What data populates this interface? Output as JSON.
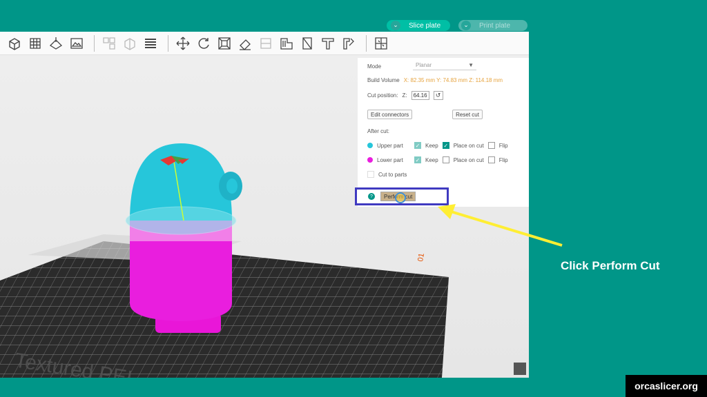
{
  "titlebar": {
    "slice_label": "Slice plate",
    "print_label": "Print plate",
    "dropdown_glyph": "⌄"
  },
  "toolbar": {
    "icons": [
      "add-object-icon",
      "grid-arrange-icon",
      "orient-icon",
      "plate-view-icon",
      "split-objects-icon",
      "split-parts-icon",
      "layers-icon",
      "move-icon",
      "rotate-icon",
      "scale-icon",
      "lay-on-face-icon",
      "cut-icon",
      "variable-layer-icon",
      "seam-icon",
      "text-icon",
      "support-paint-icon",
      "assembly-icon"
    ]
  },
  "cut_panel": {
    "mode_label": "Mode",
    "mode_value": "Planar",
    "mode_arrow": "▼",
    "build_volume_label": "Build Volume",
    "build_volume_values": "X: 82.35 mm  Y: 74.83 mm  Z: 114.18 mm",
    "cut_position_label": "Cut position:",
    "axis_label": "Z:",
    "cut_position_value": "64.16",
    "reset_glyph": "↺",
    "edit_connectors_label": "Edit connectors",
    "reset_cut_label": "Reset cut",
    "after_cut_label": "After cut:",
    "upper_part_label": "Upper part",
    "lower_part_label": "Lower part",
    "keep_label": "Keep",
    "place_on_cut_label": "Place on cut",
    "flip_label": "Flip",
    "cut_to_parts_label": "Cut to parts",
    "perform_cut_label": "Perform cut",
    "help_glyph": "?"
  },
  "colors": {
    "accent": "#009688",
    "upper_part": "#26c6da",
    "lower_part": "#e91ede",
    "highlight_box": "#3f3ac0",
    "arrow": "#ffee33"
  },
  "callout": {
    "text": "Click Perform Cut"
  },
  "brand": {
    "text": "orcaslicer.org"
  }
}
